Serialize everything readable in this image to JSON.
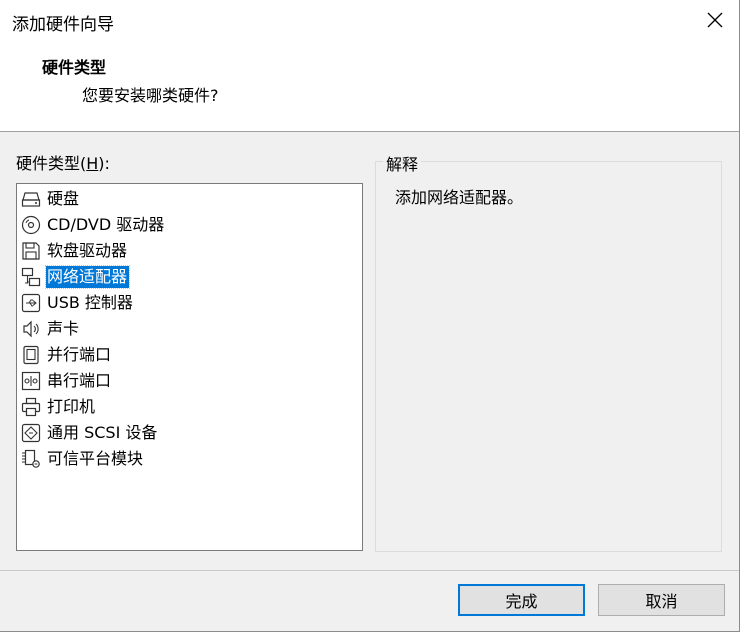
{
  "window": {
    "title": "添加硬件向导"
  },
  "header": {
    "title": "硬件类型",
    "subtitle": "您要安装哪类硬件?"
  },
  "hardware_list": {
    "label_prefix": "硬件类型(",
    "label_mnemonic": "H",
    "label_suffix": "):",
    "items": [
      {
        "label": "硬盘",
        "icon": "hard-disk-icon"
      },
      {
        "label": "CD/DVD 驱动器",
        "icon": "cd-dvd-icon"
      },
      {
        "label": "软盘驱动器",
        "icon": "floppy-icon"
      },
      {
        "label": "网络适配器",
        "icon": "network-adapter-icon",
        "selected": true
      },
      {
        "label": "USB 控制器",
        "icon": "usb-icon"
      },
      {
        "label": "声卡",
        "icon": "speaker-icon"
      },
      {
        "label": "并行端口",
        "icon": "parallel-port-icon"
      },
      {
        "label": "串行端口",
        "icon": "serial-port-icon"
      },
      {
        "label": "打印机",
        "icon": "printer-icon"
      },
      {
        "label": "通用 SCSI 设备",
        "icon": "scsi-icon"
      },
      {
        "label": "可信平台模块",
        "icon": "tpm-icon"
      }
    ]
  },
  "explanation": {
    "legend": "解释",
    "text": "添加网络适配器。"
  },
  "buttons": {
    "finish": "完成",
    "cancel": "取消"
  },
  "colors": {
    "selection": "#0078d7",
    "default_button_border": "#0078d7"
  }
}
